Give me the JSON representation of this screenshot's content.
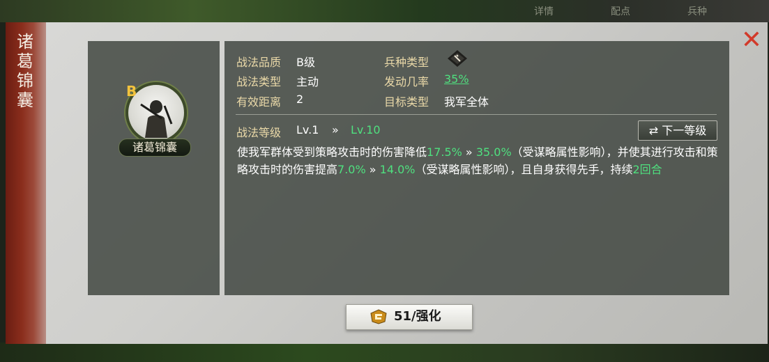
{
  "background_tabs": [
    "详情",
    "配点",
    "兵种"
  ],
  "side_title": [
    "诸",
    "葛",
    "锦",
    "囊"
  ],
  "close_icon": "close-icon",
  "skill": {
    "grade": "B",
    "name": "诸葛锦囊",
    "portrait_icon": "warrior-portrait-icon"
  },
  "info": {
    "quality_label": "战法品质",
    "quality_value": "B级",
    "type_label": "战法类型",
    "type_value": "主动",
    "range_label": "有效距离",
    "range_value": "2",
    "troop_label": "兵种类型",
    "troop_icon": "troop-type-icon",
    "chance_label": "发动几率",
    "chance_value": "35%",
    "target_label": "目标类型",
    "target_value": "我军全体"
  },
  "level": {
    "label": "战法等级",
    "current": "Lv.1",
    "arrow": "»",
    "max": "Lv.10",
    "next_button_icon": "swap-arrows-icon",
    "next_button_label": "下一等级"
  },
  "description": {
    "t1": "使我军群体受到策略攻击时的伤害降低",
    "v1": "17.5%",
    "a1": " » ",
    "v2": "35.0%",
    "t2": "（受谋略属性影响），并使其进行攻击和策略攻击时的伤害提高",
    "v3": "7.0%",
    "a2": " » ",
    "v4": "14.0%",
    "t3": "（受谋略属性影响），且自身获得先手，持续",
    "v5": "2回合"
  },
  "enhance": {
    "icon": "enhance-badge-icon",
    "label": "51/强化"
  },
  "colors": {
    "label_gold": "#ead9a8",
    "highlight_green": "#4fe07f",
    "close_red": "#d23a2a",
    "grade_gold": "#f3c33d"
  }
}
